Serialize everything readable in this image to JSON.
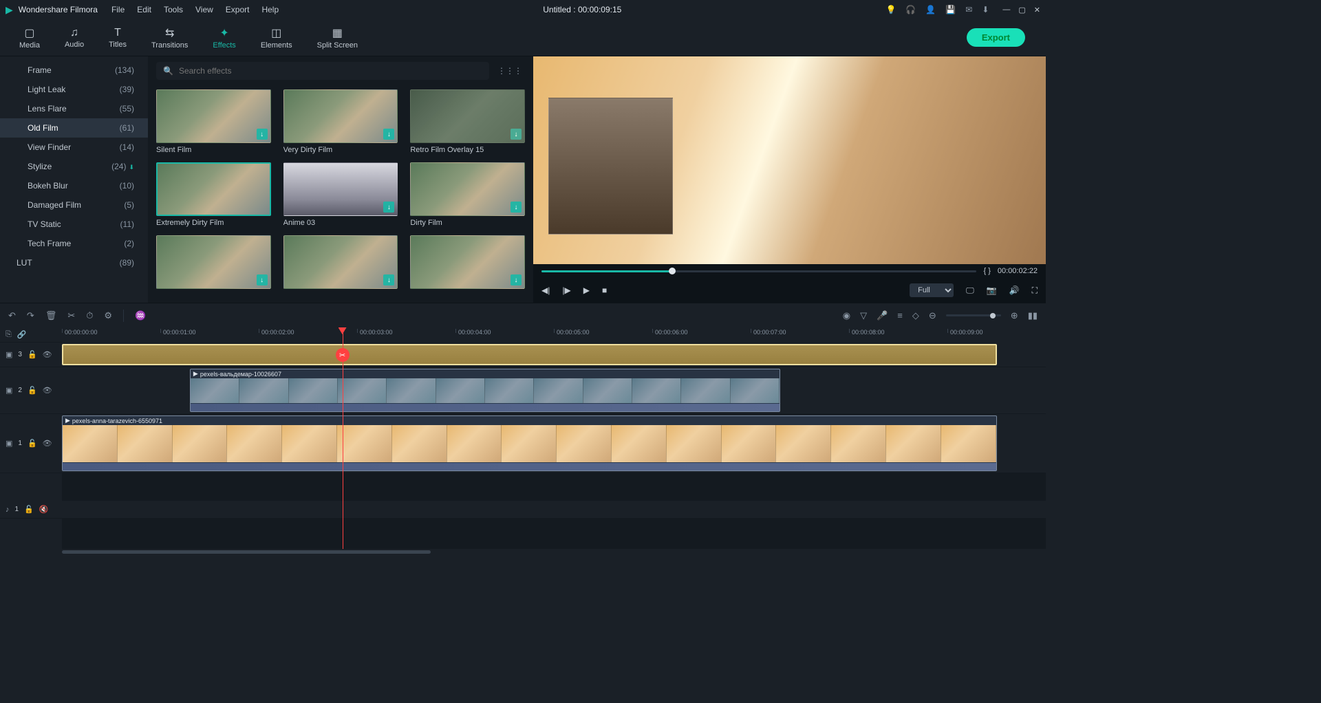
{
  "app": {
    "name": "Wondershare Filmora",
    "title": "Untitled : 00:00:09:15"
  },
  "menus": [
    "File",
    "Edit",
    "Tools",
    "View",
    "Export",
    "Help"
  ],
  "main_tabs": [
    {
      "label": "Media",
      "icon": "📁"
    },
    {
      "label": "Audio",
      "icon": "♪"
    },
    {
      "label": "Titles",
      "icon": "T"
    },
    {
      "label": "Transitions",
      "icon": "⇄"
    },
    {
      "label": "Effects",
      "icon": "✦",
      "active": true
    },
    {
      "label": "Elements",
      "icon": "◫"
    },
    {
      "label": "Split Screen",
      "icon": "▦"
    }
  ],
  "export_label": "Export",
  "sidebar": {
    "items": [
      {
        "label": "Frame",
        "count": "(134)"
      },
      {
        "label": "Light Leak",
        "count": "(39)"
      },
      {
        "label": "Lens Flare",
        "count": "(55)"
      },
      {
        "label": "Old Film",
        "count": "(61)",
        "active": true
      },
      {
        "label": "View Finder",
        "count": "(14)"
      },
      {
        "label": "Stylize",
        "count": "(24)",
        "dl": true
      },
      {
        "label": "Bokeh Blur",
        "count": "(10)"
      },
      {
        "label": "Damaged Film",
        "count": "(5)"
      },
      {
        "label": "TV Static",
        "count": "(11)"
      },
      {
        "label": "Tech Frame",
        "count": "(2)"
      },
      {
        "label": "LUT",
        "count": "(89)",
        "top": true
      }
    ]
  },
  "search": {
    "placeholder": "Search effects"
  },
  "effects": [
    {
      "name": "Silent Film",
      "dl": true
    },
    {
      "name": "Very Dirty Film",
      "dl": true
    },
    {
      "name": "Retro Film Overlay 15",
      "dl": true,
      "variant": "retro"
    },
    {
      "name": "Extremely Dirty Film",
      "selected": true
    },
    {
      "name": "Anime 03",
      "dl": true,
      "variant": "anime"
    },
    {
      "name": "Dirty Film",
      "dl": true
    },
    {
      "name": "",
      "dl": true
    },
    {
      "name": "",
      "dl": true
    },
    {
      "name": "",
      "dl": true
    }
  ],
  "preview": {
    "time": "00:00:02:22",
    "markers": "{    }",
    "quality": "Full"
  },
  "timeline": {
    "ticks": [
      "00:00:00:00",
      "00:00:01:00",
      "00:00:02:00",
      "00:00:03:00",
      "00:00:04:00",
      "00:00:05:00",
      "00:00:06:00",
      "00:00:07:00",
      "00:00:08:00",
      "00:00:09:00"
    ],
    "track3": {
      "label": "3"
    },
    "track2": {
      "label": "2",
      "clip_name": "pexels-вальдемар-10026607"
    },
    "track1": {
      "label": "1",
      "clip_name": "pexels-anna-tarazevich-6550971"
    },
    "audio": {
      "label": "1"
    }
  }
}
